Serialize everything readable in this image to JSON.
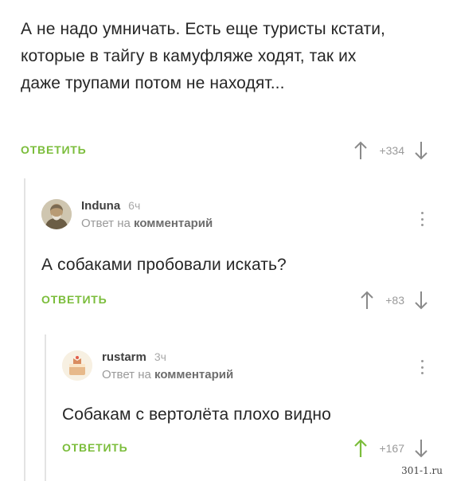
{
  "colors": {
    "accent_green": "#7bbd3b",
    "text": "#262626",
    "muted": "#9a9a9a"
  },
  "reply_label": "ОТВЕТИТЬ",
  "comments": [
    {
      "text": "А не надо умничать. Есть еще туристы кстати, которые в тайгу в камуфляже ходят, так их даже трупами потом не находят...",
      "rating": "+334",
      "upvoted": false
    },
    {
      "author": "Induna",
      "time": "6ч",
      "reply_prefix": "Ответ на",
      "reply_target": "комментарий",
      "avatar": "man-portrait-icon",
      "text": "А собаками пробовали искать?",
      "rating": "+83",
      "upvoted": false
    },
    {
      "author": "rustarm",
      "time": "3ч",
      "reply_prefix": "Ответ на",
      "reply_target": "комментарий",
      "avatar": "cake-icon",
      "text": "Собакам с вертолёта плохо видно",
      "rating": "+167",
      "upvoted": true
    }
  ],
  "watermark": "301-1.ru"
}
